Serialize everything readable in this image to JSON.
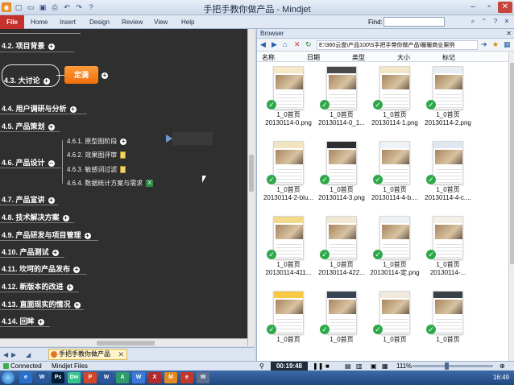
{
  "window": {
    "title": "手把手教你做产品 - Mindjet"
  },
  "ribbon": {
    "file": "File",
    "tabs": [
      "Home",
      "Insert",
      "Design",
      "Review",
      "View",
      "Help"
    ],
    "find_label": "Find:"
  },
  "mindmap": {
    "topics": [
      {
        "label": "4.2. 项目背景"
      },
      {
        "label": "4.3. 大讨论"
      },
      {
        "label": "4.4. 用户调研与分析"
      },
      {
        "label": "4.5. 产品策划"
      },
      {
        "label": "4.6. 产品设计"
      },
      {
        "label": "4.7. 产品宣讲"
      },
      {
        "label": "4.8. 技术解决方案"
      },
      {
        "label": "4.9. 产品研发与项目管理"
      },
      {
        "label": "4.10. 产品测试"
      },
      {
        "label": "4.11. 坎坷的产品发布"
      },
      {
        "label": "4.12. 新版本的改进"
      },
      {
        "label": "4.13. 直面现实的情况"
      },
      {
        "label": "4.14. 回眸"
      }
    ],
    "callout": "定调",
    "subtopics": [
      {
        "label": "4.6.1. 原型图阶段"
      },
      {
        "label": "4.6.2. 效果图评审"
      },
      {
        "label": "4.6.3. 敏感词过滤"
      },
      {
        "label": "4.6.4. 数据统计方案与需求"
      }
    ]
  },
  "doc_tab": {
    "label": "手把手教你做产品"
  },
  "browser": {
    "title": "Browser",
    "path": "E:\\360云盘\\产品100\\S手把手带你做产品\\暖暖商业案例",
    "columns": [
      "名称",
      "日期",
      "类型",
      "大小",
      "标记"
    ],
    "files": [
      {
        "line1": "1_0首页",
        "line2": "20130114-0.png"
      },
      {
        "line1": "1_0首页",
        "line2": "20130114-0_1..."
      },
      {
        "line1": "1_0首页",
        "line2": "20130114-1.png"
      },
      {
        "line1": "1_0首页",
        "line2": "20130114-2.png"
      },
      {
        "line1": "1_0首页",
        "line2": "20130114-2-blu..."
      },
      {
        "line1": "1_0首页",
        "line2": "20130114-3.png"
      },
      {
        "line1": "1_0首页",
        "line2": "20130114-4-b...."
      },
      {
        "line1": "1_0首页",
        "line2": "20130114-4-c...."
      },
      {
        "line1": "1_0首页",
        "line2": "20130114-411..."
      },
      {
        "line1": "1_0首页",
        "line2": "20130114-422..."
      },
      {
        "line1": "1_0首页",
        "line2": "20130114-定.png"
      },
      {
        "line1": "1_0首页",
        "line2": "20130114-..."
      },
      {
        "line1": "1_0首页",
        "line2": ""
      },
      {
        "line1": "1_0首页",
        "line2": ""
      },
      {
        "line1": "1_0首页",
        "line2": ""
      },
      {
        "line1": "1_0首页",
        "line2": ""
      }
    ]
  },
  "statusbar": {
    "connected": "Connected",
    "files": "Mindjet Files",
    "timer": "00:19:48",
    "zoom": "111%"
  },
  "taskbar": {
    "clock": "16:49",
    "apps": [
      "e",
      "W",
      "Ps",
      "Dw",
      "P",
      "W",
      "A",
      "W",
      "X",
      "M",
      "e",
      "W"
    ]
  },
  "colors": {
    "canvas_bg": "#2f2f2f",
    "callout": "#f07a14",
    "check": "#2fa84a",
    "file_tab": "#c5322d"
  }
}
